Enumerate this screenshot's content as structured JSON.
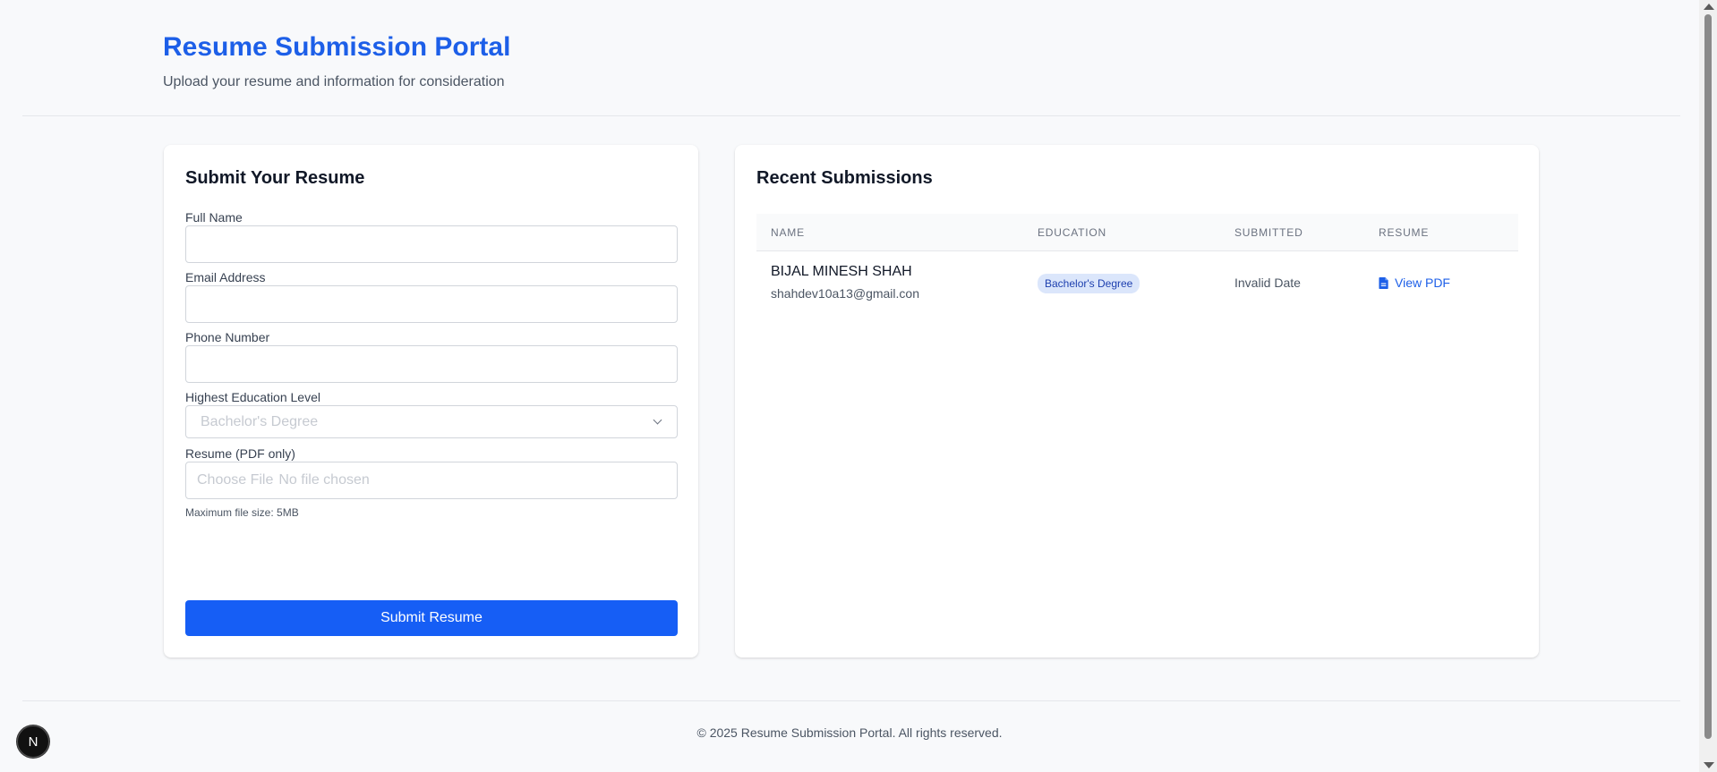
{
  "header": {
    "title": "Resume Submission Portal",
    "subtitle": "Upload your resume and information for consideration"
  },
  "form": {
    "title": "Submit Your Resume",
    "full_name_label": "Full Name",
    "full_name_value": "",
    "email_label": "Email Address",
    "email_value": "",
    "phone_label": "Phone Number",
    "phone_value": "",
    "education_label": "Highest Education Level",
    "education_selected": "Bachelor's Degree",
    "resume_label": "Resume (PDF only)",
    "file_button": "Choose File",
    "file_status": "No file chosen",
    "file_hint": "Maximum file size: 5MB",
    "submit_label": "Submit Resume"
  },
  "submissions": {
    "title": "Recent Submissions",
    "columns": [
      "NAME",
      "EDUCATION",
      "SUBMITTED",
      "RESUME"
    ],
    "rows": [
      {
        "name": "BIJAL MINESH SHAH",
        "email": "shahdev10a13@gmail.con",
        "education": "Bachelor's Degree",
        "submitted": "Invalid Date",
        "resume_link": "View PDF"
      }
    ]
  },
  "footer": {
    "copyright": "© 2025 Resume Submission Portal. All rights reserved."
  },
  "dev_badge": {
    "letter": "N"
  },
  "colors": {
    "accent": "#1d5fe8",
    "button": "#165ef5",
    "badge_bg": "#dbe6fb",
    "background": "#f8f9fb"
  },
  "icons": [
    "chevron-down-icon",
    "document-icon",
    "nextjs-logo-icon"
  ]
}
